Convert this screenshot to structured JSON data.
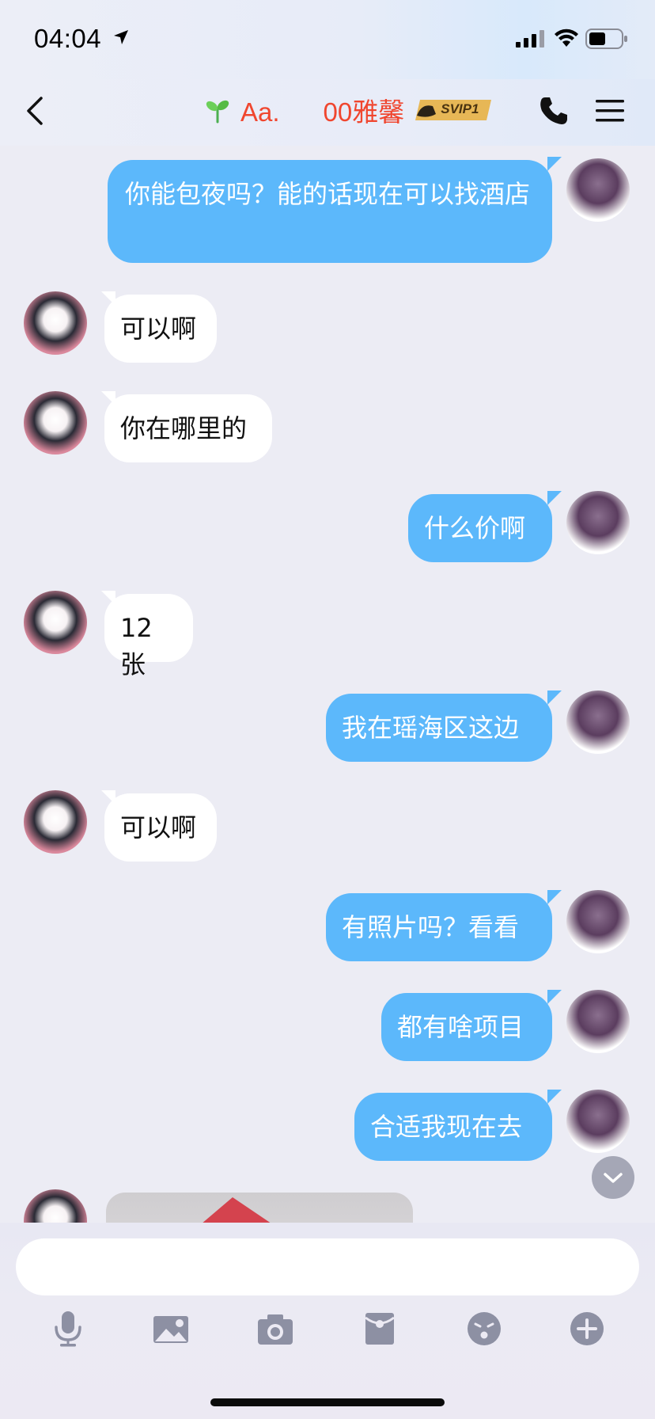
{
  "status_bar": {
    "time": "04:04",
    "icons": [
      "location-arrow-icon",
      "signal-icon",
      "wifi-icon",
      "battery-icon"
    ]
  },
  "header": {
    "back_icon": "chevron-left-icon",
    "badge_icon": "sprout-icon",
    "contact_name": "Aa.      00雅馨",
    "vip_badge": "SVIP1",
    "call_icon": "phone-icon",
    "menu_icon": "menu-icon"
  },
  "messages": [
    {
      "from": "me",
      "text": "你能包夜吗？能的话现在可以找酒店"
    },
    {
      "from": "her",
      "text": "可以啊"
    },
    {
      "from": "her",
      "text": "你在哪里的"
    },
    {
      "from": "me",
      "text": "什么价啊"
    },
    {
      "from": "her",
      "text": "12张"
    },
    {
      "from": "me",
      "text": "我在瑶海区这边"
    },
    {
      "from": "her",
      "text": "可以啊"
    },
    {
      "from": "me",
      "text": "有照片吗？看看"
    },
    {
      "from": "me",
      "text": "都有啥项目"
    },
    {
      "from": "me",
      "text": "合适我现在去"
    },
    {
      "from": "her",
      "type": "image"
    }
  ],
  "input": {
    "value": "",
    "placeholder": ""
  },
  "toolbar": [
    "microphone-icon",
    "image-icon",
    "camera-icon",
    "red-packet-icon",
    "emoji-icon",
    "plus-icon"
  ],
  "colors": {
    "my_bubble": "#5cb8fb",
    "her_bubble": "#ffffff",
    "name_red": "#f0462f",
    "background": "#ececf4"
  }
}
